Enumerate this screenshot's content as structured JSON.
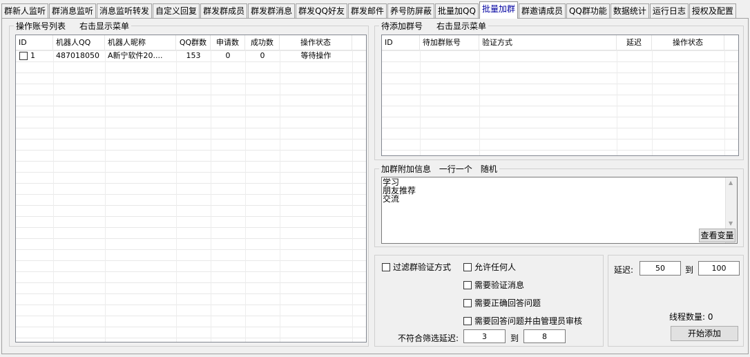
{
  "tabs": [
    "群新人监听",
    "群消息监听",
    "消息监听转发",
    "自定义回复",
    "群发群成员",
    "群发群消息",
    "群发QQ好友",
    "群发邮件",
    "养号防屏蔽",
    "批量加QQ",
    "批量加群",
    "群邀请成员",
    "QQ群功能",
    "数据统计",
    "运行日志",
    "授权及配置"
  ],
  "active_tab_index": 10,
  "accounts_panel": {
    "title": "操作账号列表",
    "hint": "右击显示菜单",
    "columns": [
      "ID",
      "机器人QQ",
      "机器人昵称",
      "QQ群数",
      "申请数",
      "成功数",
      "操作状态"
    ],
    "rows": [
      {
        "checked": false,
        "id": "1",
        "qq": "487018050",
        "nickname": "A新宁软件20....",
        "group_count": "153",
        "apply": "0",
        "success": "0",
        "status": "等待操作"
      }
    ]
  },
  "pending_panel": {
    "title": "待添加群号",
    "hint": "右击显示菜单",
    "columns": [
      "ID",
      "待加群账号",
      "验证方式",
      "延迟",
      "操作状态"
    ],
    "rows": []
  },
  "extra_info": {
    "title": "加群附加信息",
    "hint1": "一行一个",
    "hint2": "随机",
    "lines": [
      "学习",
      "朋友推荐",
      "交流"
    ],
    "view_button": "查看变量"
  },
  "options": {
    "filter_label": "过滤群验证方式",
    "filter_checked": false,
    "allow_anyone": "允许任何人",
    "need_verify": "需要验证消息",
    "need_answer": "需要正确回答问题",
    "need_admin": "需要回答问题并由管理员审核",
    "mismatch_delay_label": "不符合筛选延迟:",
    "mismatch_from": "3",
    "to_label": "到",
    "mismatch_to": "8"
  },
  "controls": {
    "delay_label": "延迟:",
    "delay_from": "50",
    "to_label": "到",
    "delay_to": "100",
    "thread_label": "线程数量: 0",
    "start_button": "开始添加"
  }
}
